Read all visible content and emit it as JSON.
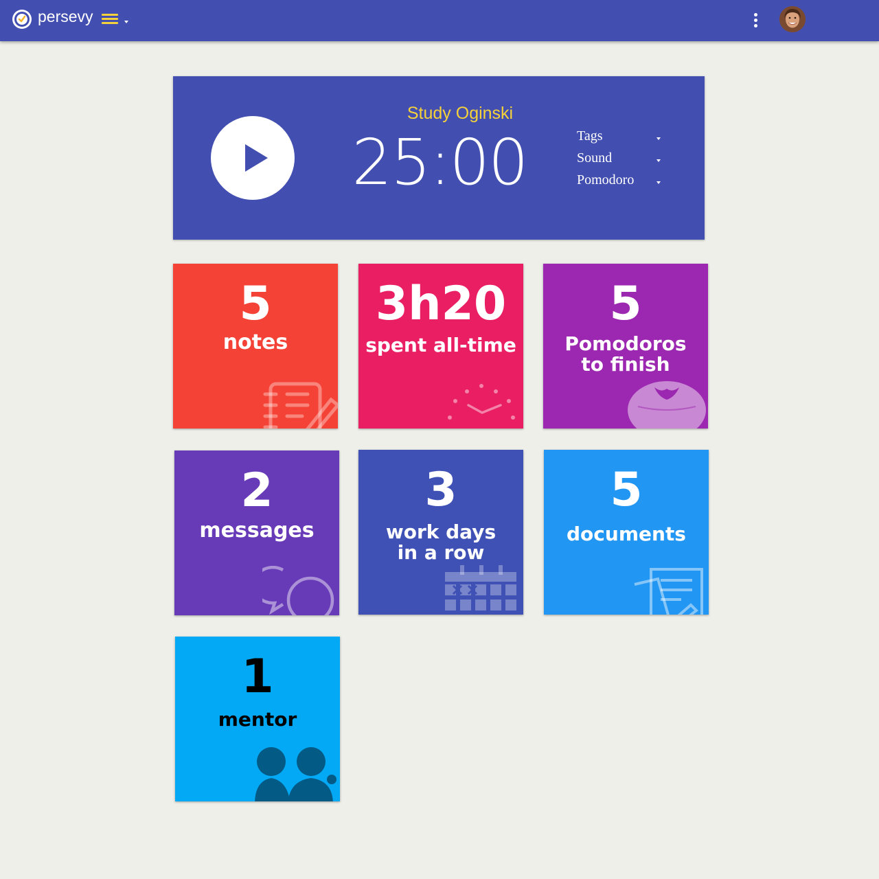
{
  "header": {
    "brand": "persevy",
    "logo_icon": "clock-check-icon",
    "menu_icon": "hamburger-icon",
    "more_icon": "more-vertical-icon",
    "avatar": "user-avatar",
    "bar_color": "#434fb0",
    "accent_color": "#f5d23a"
  },
  "timer": {
    "task": "Study Oginski",
    "time": "25:00",
    "play_icon": "play-icon",
    "options": [
      "Tags",
      "Sound",
      "Pomodoro"
    ]
  },
  "tiles": [
    {
      "value": "5",
      "label": "notes",
      "icon": "notes-pencil-icon",
      "color": "#f44336"
    },
    {
      "value": "3h20",
      "label": "spent all-time",
      "icon": "clock-dots-icon",
      "color": "#e91e63"
    },
    {
      "value": "5",
      "label_line1": "Pomodoros",
      "label_line2": "to finish",
      "icon": "tomato-icon",
      "color": "#9c27b0"
    },
    {
      "value": "2",
      "label": "messages",
      "icon": "chat-bubbles-icon",
      "color": "#673ab7"
    },
    {
      "value": "3",
      "label_line1": "work days",
      "label_line2": "in a row",
      "icon": "calendar-icon",
      "color": "#3f51b5"
    },
    {
      "value": "5",
      "label": "documents",
      "icon": "documents-icon",
      "color": "#2196f3"
    },
    {
      "value": "1",
      "label": "mentor",
      "icon": "people-icon",
      "color": "#03a9f4"
    }
  ]
}
